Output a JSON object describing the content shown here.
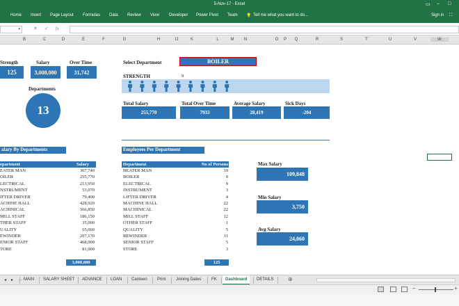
{
  "window": {
    "title": "5-Nov-17 - Excel"
  },
  "ribbon": {
    "tabs": [
      "Home",
      "Insert",
      "Page Layout",
      "Formulas",
      "Data",
      "Review",
      "View",
      "Developer",
      "Power Pivot",
      "Team"
    ],
    "tell_me": "Tell me what you want to do...",
    "sign_in": "Sign in"
  },
  "formula_bar": {
    "name_box": "",
    "fx": "fx",
    "value": ""
  },
  "columns": [
    "B",
    "C",
    "D",
    "E",
    "F",
    "G",
    "H",
    "IJ",
    "K",
    "L",
    "M",
    "N",
    "O",
    "P",
    "Q",
    "R",
    "S",
    "T",
    "U",
    "V",
    "W"
  ],
  "kpis": {
    "strength_label": "Strength",
    "strength_value": "125",
    "salary_label": "Salary",
    "salary_value": "3,008,080",
    "overtime_label": "Over Time",
    "overtime_value": "31,742",
    "departments_label": "Departments",
    "departments_value": "13"
  },
  "selector": {
    "label": "Select Department",
    "value": "BOILER"
  },
  "strength_row": {
    "label": "STRENGTH",
    "value": "9",
    "person_count": 9
  },
  "summary": [
    {
      "label": "Total Salary",
      "value": "255,770"
    },
    {
      "label": "Total Over Time",
      "value": "7933"
    },
    {
      "label": "Average Salary",
      "value": "28,419"
    },
    {
      "label": "Sick Days",
      "value": "-204"
    }
  ],
  "salary_by_dept": {
    "title": "alary By Departments",
    "col_dept": "epartment",
    "col_salary": "Salary",
    "rows": [
      [
        "EATER MAN",
        "367,740"
      ],
      [
        "OILER",
        "255,770"
      ],
      [
        "LECTRICAL",
        "213,950"
      ],
      [
        "NSTRUMENT",
        "53,070"
      ],
      [
        "IFTER DRIVER",
        "79,400"
      ],
      [
        "ACHINE HALL",
        "428,920"
      ],
      [
        "ACHINICAL",
        "566,850"
      ],
      [
        "MILL STAFF",
        "186,150"
      ],
      [
        "THER STAFF",
        "35,000"
      ],
      [
        "UALITY",
        "65,060"
      ],
      [
        "EWINDER",
        "207,170"
      ],
      [
        "ENIOR STAFF",
        "468,000"
      ],
      [
        "TORE",
        "81,000"
      ]
    ],
    "total": "3,008,080"
  },
  "employees_per_dept": {
    "title": "Employees Per Department",
    "col_dept": "Department",
    "col_count": "No of Persons",
    "rows": [
      [
        "BEATER MAN",
        "19"
      ],
      [
        "BOILER",
        "9"
      ],
      [
        "ELECTRICAL",
        "9"
      ],
      [
        "INSTRUMENT",
        "3"
      ],
      [
        "LIFTER DRIVER",
        "4"
      ],
      [
        "MACHINE HALL",
        "22"
      ],
      [
        "MACHINICAL",
        "22"
      ],
      [
        "MILL STAFF",
        "12"
      ],
      [
        "OTHER STAFF",
        "1"
      ],
      [
        "QUALITY",
        "5"
      ],
      [
        "REWINDER",
        "11"
      ],
      [
        "SENIOR STAFF",
        "5"
      ],
      [
        "STORE",
        "3"
      ]
    ],
    "total": "125"
  },
  "salary_stats": [
    {
      "label": "Max Salary",
      "value": "109,848"
    },
    {
      "label": "Min Salary",
      "value": "3,750"
    },
    {
      "label": "Avg Salary",
      "value": "24,060"
    }
  ],
  "sheet_tabs": [
    "MAIN",
    "SALARY SHEET",
    "ADVANCE",
    "LOAN",
    "Canteen",
    "Print",
    "Joining Dates",
    "FK",
    "Dashboard",
    "DETAILS"
  ],
  "active_sheet": "Dashboard",
  "colors": {
    "excel_green": "#217346",
    "accent_blue": "#2e75b6",
    "light_blue_band": "#bdd7ee",
    "dropdown_border": "#c00000"
  }
}
